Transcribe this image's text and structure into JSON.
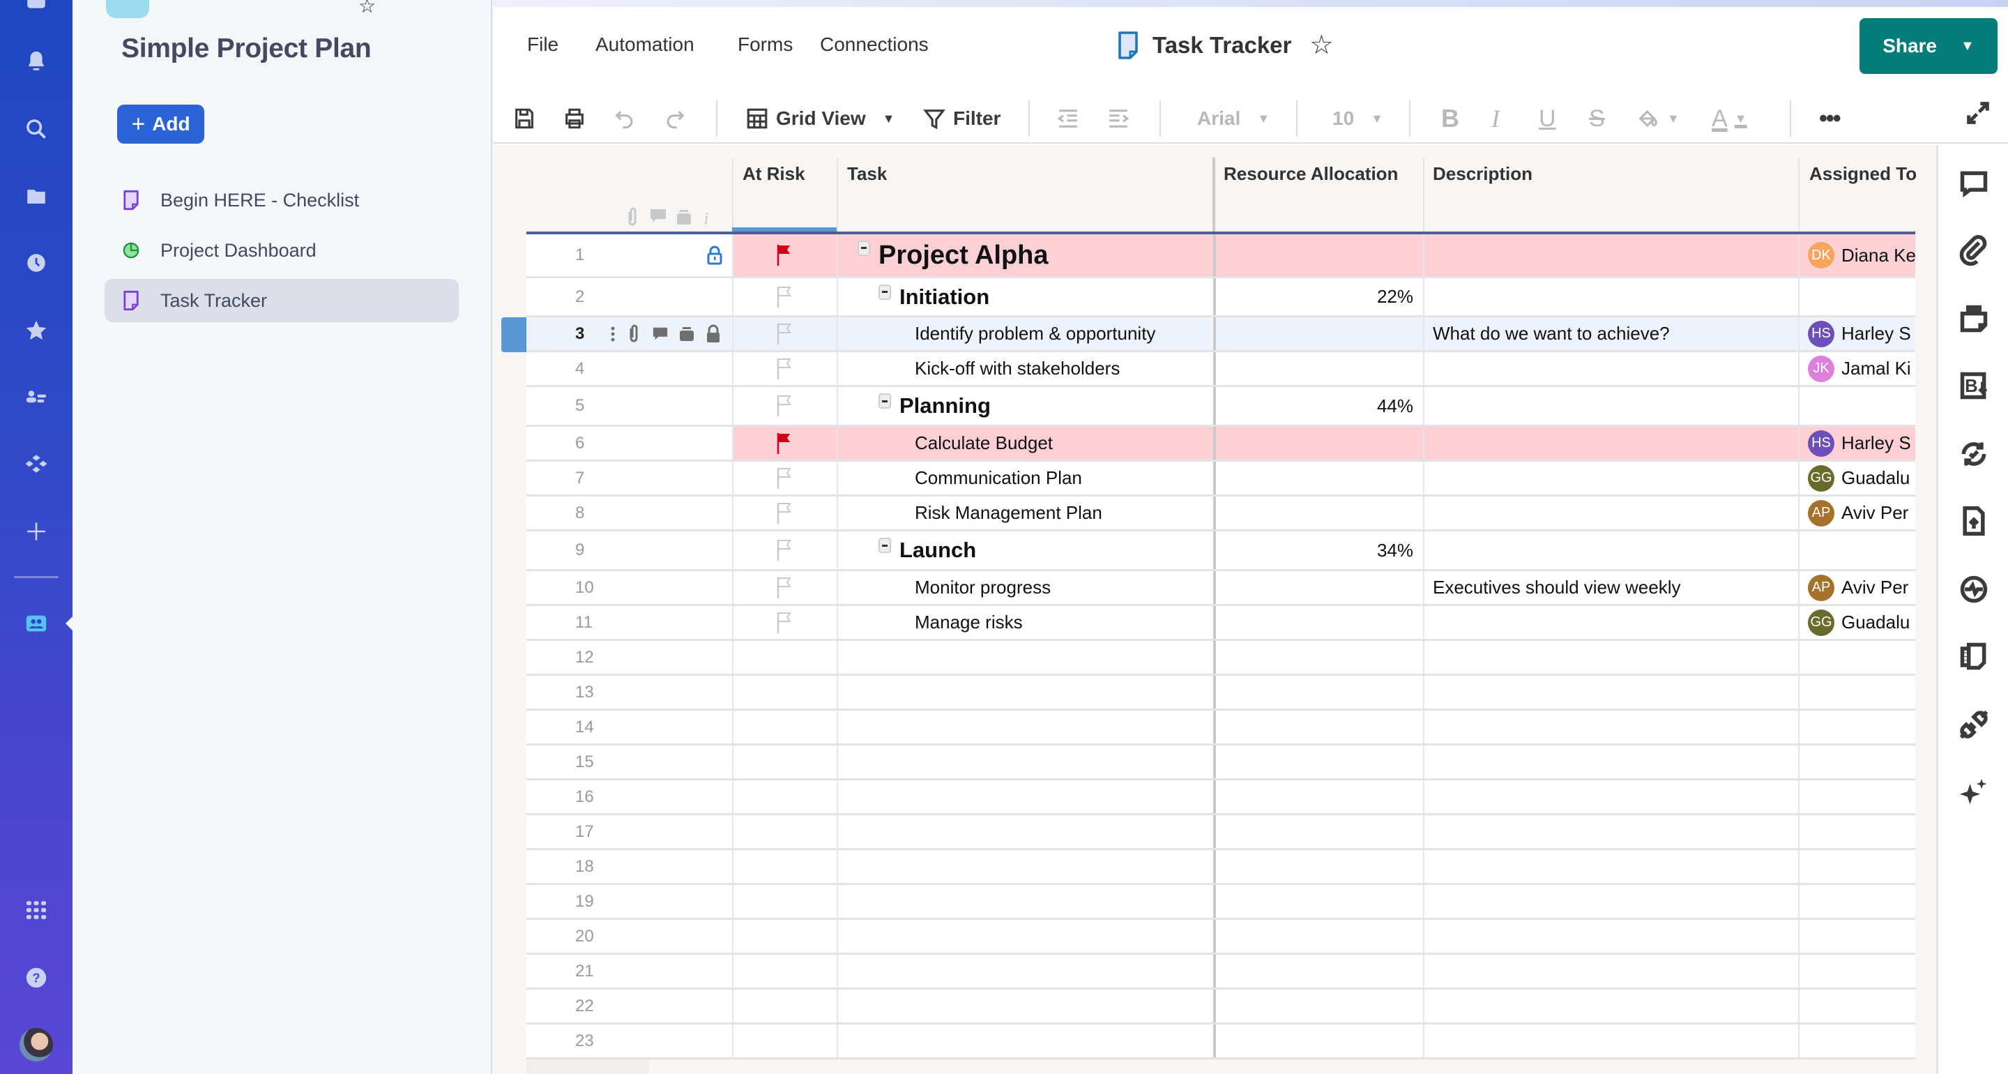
{
  "workspace": {
    "title": "Simple Project Plan",
    "add_label": "Add",
    "items": [
      {
        "label": "Begin HERE - Checklist",
        "icon": "sheet-icon",
        "active": false
      },
      {
        "label": "Project Dashboard",
        "icon": "dashboard-icon",
        "active": false
      },
      {
        "label": "Task Tracker",
        "icon": "sheet-icon",
        "active": true
      }
    ]
  },
  "rail": {
    "icons": [
      "home-icon",
      "bell-icon",
      "search-icon",
      "folder-icon",
      "clock-icon",
      "star-icon",
      "contacts-icon",
      "apps-icon",
      "plus-icon",
      "workspace-icon",
      "launcher-icon",
      "help-icon",
      "user-avatar"
    ]
  },
  "menu": {
    "items": [
      "File",
      "Automation",
      "Forms",
      "Connections"
    ]
  },
  "document": {
    "title": "Task Tracker",
    "share_label": "Share"
  },
  "toolbar": {
    "view_label": "Grid View",
    "filter_label": "Filter",
    "font_label": "Arial",
    "size_label": "10"
  },
  "colors": {
    "share": "#047d7a",
    "add_button": "#2a63d6",
    "at_risk_row": "#fdd0d6",
    "selected_row": "#edf2fb",
    "flag_red": "#d0021b"
  },
  "grid": {
    "columns": [
      "At Risk",
      "Task",
      "Resource Allocation",
      "Description",
      "Assigned To"
    ],
    "rows": [
      {
        "num": "1",
        "at_risk": true,
        "task": "Project Alpha",
        "level": 0,
        "collapsible": true,
        "resource": "",
        "description": "",
        "assignee": {
          "initials": "DK",
          "name": "Diana Ke",
          "color": "#f7a55c"
        },
        "locked": true
      },
      {
        "num": "2",
        "at_risk": false,
        "task": "Initiation",
        "level": 1,
        "collapsible": true,
        "resource": "22%",
        "description": "",
        "assignee": null
      },
      {
        "num": "3",
        "at_risk": false,
        "task": "Identify problem & opportunity",
        "level": 2,
        "resource": "",
        "description": "What do we want to achieve?",
        "assignee": {
          "initials": "HS",
          "name": "Harley S",
          "color": "#6c4fb8"
        },
        "selected": true
      },
      {
        "num": "4",
        "at_risk": false,
        "task": "Kick-off with stakeholders",
        "level": 2,
        "resource": "",
        "description": "",
        "assignee": {
          "initials": "JK",
          "name": "Jamal Ki",
          "color": "#df7fdc"
        }
      },
      {
        "num": "5",
        "at_risk": false,
        "task": "Planning",
        "level": 1,
        "collapsible": true,
        "resource": "44%",
        "description": "",
        "assignee": null
      },
      {
        "num": "6",
        "at_risk": true,
        "task": "Calculate Budget",
        "level": 2,
        "resource": "",
        "description": "",
        "assignee": {
          "initials": "HS",
          "name": "Harley S",
          "color": "#6c4fb8"
        }
      },
      {
        "num": "7",
        "at_risk": false,
        "task": "Communication Plan",
        "level": 2,
        "resource": "",
        "description": "",
        "assignee": {
          "initials": "GG",
          "name": "Guadalu",
          "color": "#6a6a2c"
        }
      },
      {
        "num": "8",
        "at_risk": false,
        "task": "Risk Management Plan",
        "level": 2,
        "resource": "",
        "description": "",
        "assignee": {
          "initials": "AP",
          "name": "Aviv Per",
          "color": "#a4722a"
        }
      },
      {
        "num": "9",
        "at_risk": false,
        "task": "Launch",
        "level": 1,
        "collapsible": true,
        "resource": "34%",
        "description": "",
        "assignee": null
      },
      {
        "num": "10",
        "at_risk": false,
        "task": "Monitor progress",
        "level": 2,
        "resource": "",
        "description": "Executives should view weekly",
        "assignee": {
          "initials": "AP",
          "name": "Aviv Per",
          "color": "#a4722a"
        }
      },
      {
        "num": "11",
        "at_risk": false,
        "task": "Manage risks",
        "level": 2,
        "resource": "",
        "description": "",
        "assignee": {
          "initials": "GG",
          "name": "Guadalu",
          "color": "#6a6a2c"
        }
      },
      {
        "num": "12"
      },
      {
        "num": "13"
      },
      {
        "num": "14"
      },
      {
        "num": "15"
      },
      {
        "num": "16"
      },
      {
        "num": "17"
      },
      {
        "num": "18"
      },
      {
        "num": "19"
      },
      {
        "num": "20"
      },
      {
        "num": "21"
      },
      {
        "num": "22"
      },
      {
        "num": "23"
      }
    ]
  },
  "right_panel": {
    "icons": [
      "comments-icon",
      "attachments-icon",
      "proofs-icon",
      "summary-icon",
      "update-requests-icon",
      "publish-icon",
      "activity-log-icon",
      "forms-icon",
      "connections-icon",
      "ai-sparkle-icon"
    ]
  }
}
